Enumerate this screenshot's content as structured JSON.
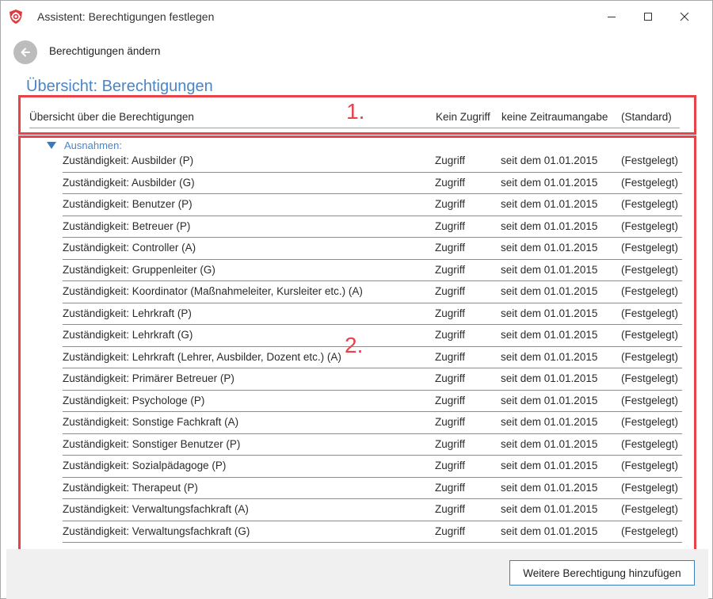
{
  "window": {
    "title": "Assistent: Berechtigungen festlegen"
  },
  "nav": {
    "back_label": "Berechtigungen ändern"
  },
  "page": {
    "title": "Übersicht: Berechtigungen"
  },
  "callouts": {
    "one": "1.",
    "two": "2."
  },
  "overview": {
    "label": "Übersicht über die Berechtigungen",
    "access": "Kein Zugriff",
    "time": "keine Zeitraumangabe",
    "state": "(Standard)"
  },
  "exceptions": {
    "header": "Ausnahmen:",
    "rows": [
      {
        "label": "Zuständigkeit: Ausbilder (P)",
        "access": "Zugriff",
        "time": "seit dem 01.01.2015",
        "state": "(Festgelegt)"
      },
      {
        "label": "Zuständigkeit: Ausbilder (G)",
        "access": "Zugriff",
        "time": "seit dem 01.01.2015",
        "state": "(Festgelegt)"
      },
      {
        "label": "Zuständigkeit: Benutzer (P)",
        "access": "Zugriff",
        "time": "seit dem 01.01.2015",
        "state": "(Festgelegt)"
      },
      {
        "label": "Zuständigkeit: Betreuer (P)",
        "access": "Zugriff",
        "time": "seit dem 01.01.2015",
        "state": "(Festgelegt)"
      },
      {
        "label": "Zuständigkeit: Controller (A)",
        "access": "Zugriff",
        "time": "seit dem 01.01.2015",
        "state": "(Festgelegt)"
      },
      {
        "label": "Zuständigkeit: Gruppenleiter (G)",
        "access": "Zugriff",
        "time": "seit dem 01.01.2015",
        "state": "(Festgelegt)"
      },
      {
        "label": "Zuständigkeit: Koordinator (Maßnahmeleiter, Kursleiter etc.) (A)",
        "access": "Zugriff",
        "time": "seit dem 01.01.2015",
        "state": "(Festgelegt)"
      },
      {
        "label": "Zuständigkeit: Lehrkraft (P)",
        "access": "Zugriff",
        "time": "seit dem 01.01.2015",
        "state": "(Festgelegt)"
      },
      {
        "label": "Zuständigkeit: Lehrkraft (G)",
        "access": "Zugriff",
        "time": "seit dem 01.01.2015",
        "state": "(Festgelegt)"
      },
      {
        "label": "Zuständigkeit: Lehrkraft (Lehrer, Ausbilder, Dozent etc.) (A)",
        "access": "Zugriff",
        "time": "seit dem 01.01.2015",
        "state": "(Festgelegt)"
      },
      {
        "label": "Zuständigkeit: Primärer Betreuer (P)",
        "access": "Zugriff",
        "time": "seit dem 01.01.2015",
        "state": "(Festgelegt)"
      },
      {
        "label": "Zuständigkeit: Psychologe (P)",
        "access": "Zugriff",
        "time": "seit dem 01.01.2015",
        "state": "(Festgelegt)"
      },
      {
        "label": "Zuständigkeit: Sonstige Fachkraft (A)",
        "access": "Zugriff",
        "time": "seit dem 01.01.2015",
        "state": "(Festgelegt)"
      },
      {
        "label": "Zuständigkeit: Sonstiger Benutzer (P)",
        "access": "Zugriff",
        "time": "seit dem 01.01.2015",
        "state": "(Festgelegt)"
      },
      {
        "label": "Zuständigkeit: Sozialpädagoge (P)",
        "access": "Zugriff",
        "time": "seit dem 01.01.2015",
        "state": "(Festgelegt)"
      },
      {
        "label": "Zuständigkeit: Therapeut (P)",
        "access": "Zugriff",
        "time": "seit dem 01.01.2015",
        "state": "(Festgelegt)"
      },
      {
        "label": "Zuständigkeit: Verwaltungsfachkraft (A)",
        "access": "Zugriff",
        "time": "seit dem 01.01.2015",
        "state": "(Festgelegt)"
      },
      {
        "label": "Zuständigkeit: Verwaltungsfachkraft (G)",
        "access": "Zugriff",
        "time": "seit dem 01.01.2015",
        "state": "(Festgelegt)"
      }
    ]
  },
  "footer": {
    "add_button_label": "Weitere Berechtigung hinzufügen"
  },
  "colors": {
    "accent": "#4a86c5",
    "callout": "#e8424a",
    "icon_red": "#e03a3e"
  },
  "icons": {
    "app": "shield-gear-icon",
    "back": "arrow-left-icon",
    "minimize": "minimize-icon",
    "maximize": "maximize-icon",
    "close": "close-icon",
    "expand": "triangle-down-icon"
  }
}
